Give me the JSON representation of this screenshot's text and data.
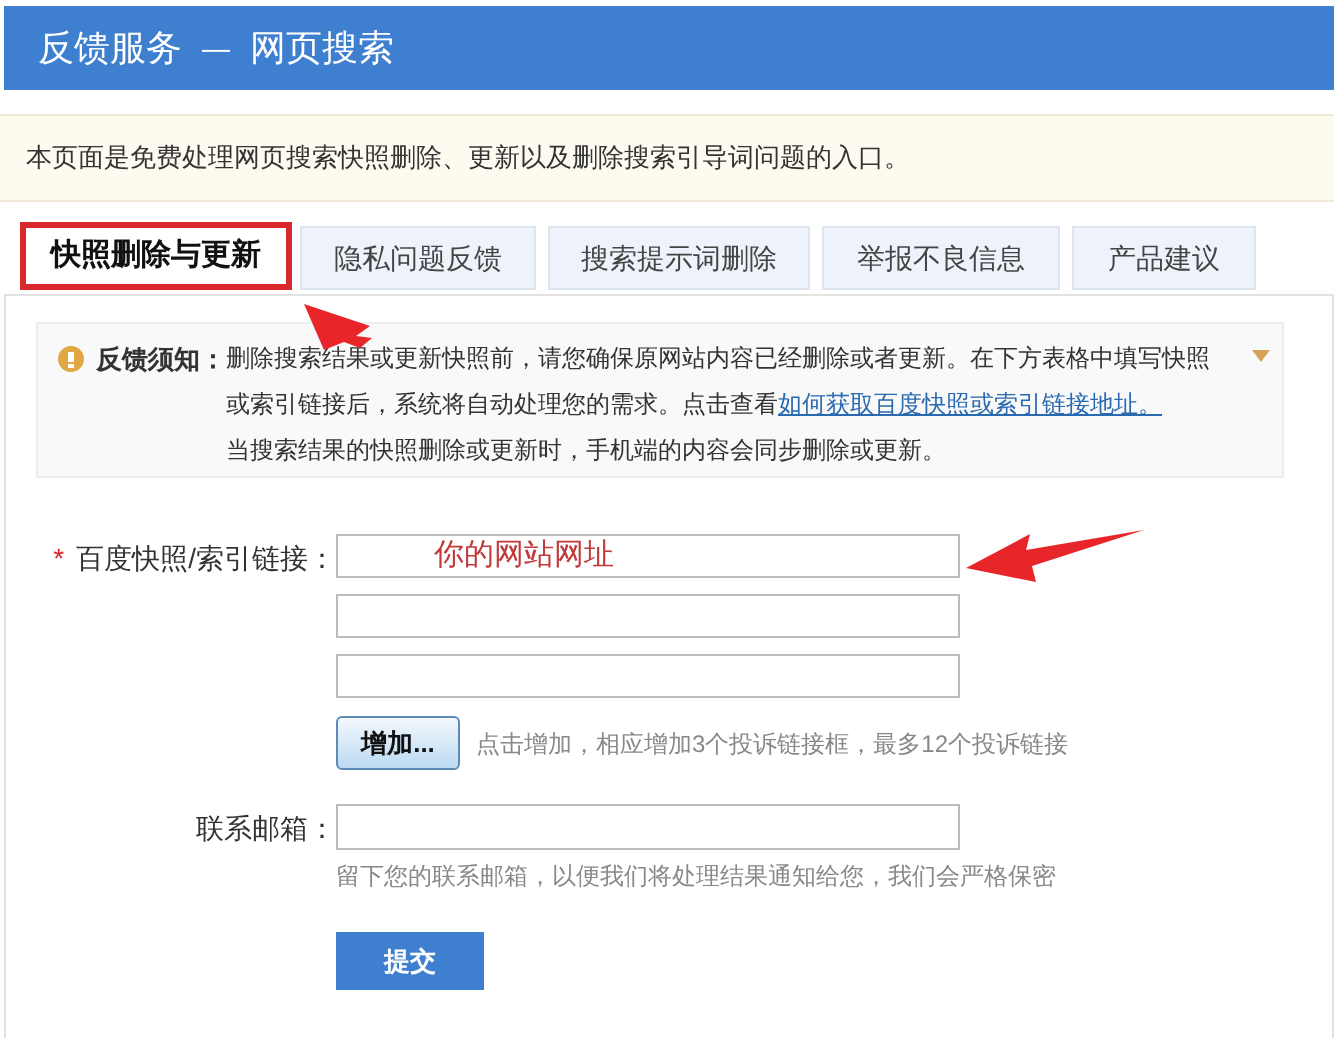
{
  "header": {
    "title": "反馈服务",
    "separator": "—",
    "subtitle": "网页搜索"
  },
  "intro": "本页面是免费处理网页搜索快照删除、更新以及删除搜索引导词问题的入口。",
  "tabs": [
    {
      "label": "快照删除与更新",
      "selected": true
    },
    {
      "label": "隐私问题反馈",
      "selected": false
    },
    {
      "label": "搜索提示词删除",
      "selected": false
    },
    {
      "label": "举报不良信息",
      "selected": false
    },
    {
      "label": "产品建议",
      "selected": false
    }
  ],
  "notice": {
    "label": "反馈须知：",
    "text": "删除搜索结果或更新快照前，请您确保原网站内容已经删除或者更新。在下方表格中填写快照或索引链接后，系统将自动处理您的需求。点击查看",
    "link": "如何获取百度快照或索引链接地址。",
    "text2": "当搜索结果的快照删除或更新时，手机端的内容会同步删除或更新。"
  },
  "form": {
    "required_mark": "*",
    "link_label": "百度快照/索引链接：",
    "link_fields": [
      {
        "kind": "filled",
        "value": "你的网站网址"
      },
      {
        "kind": "empty"
      },
      {
        "kind": "empty"
      }
    ],
    "add_button": "增加...",
    "add_hint": "点击增加，相应增加3个投诉链接框，最多12个投诉链接",
    "email_label": "联系邮箱：",
    "email_hint": "留下您的联系邮箱，以便我们将处理结果通知给您，我们会严格保密",
    "submit": "提交"
  }
}
